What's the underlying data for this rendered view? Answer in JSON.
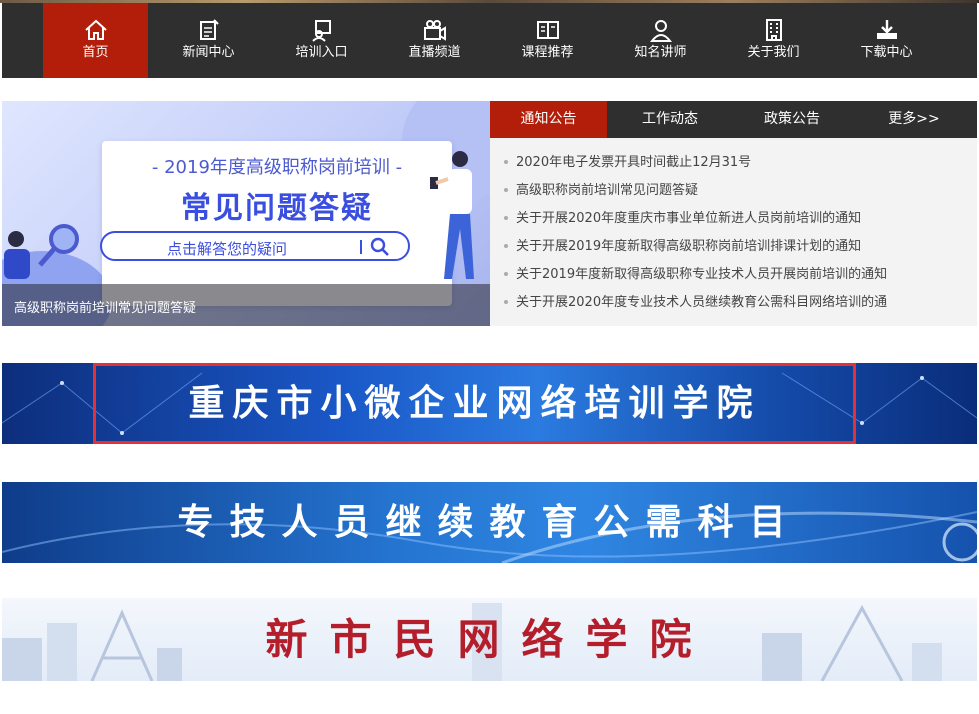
{
  "nav": {
    "items": [
      {
        "label": "首页",
        "icon": "home-icon",
        "active": true
      },
      {
        "label": "新闻中心",
        "icon": "news-edit-icon"
      },
      {
        "label": "培训入口",
        "icon": "training-icon"
      },
      {
        "label": "直播频道",
        "icon": "video-camera-icon"
      },
      {
        "label": "课程推荐",
        "icon": "book-icon"
      },
      {
        "label": "知名讲师",
        "icon": "teacher-icon"
      },
      {
        "label": "关于我们",
        "icon": "building-icon"
      },
      {
        "label": "下载中心",
        "icon": "download-icon"
      }
    ]
  },
  "hero": {
    "subtitle": "- 2019年度高级职称岗前培训 -",
    "title": "常见问题答疑",
    "search_text": "点击解答您的疑问",
    "caption": "高级职称岗前培训常见问题答疑"
  },
  "news": {
    "tabs": [
      "通知公告",
      "工作动态",
      "政策公告",
      "更多>>"
    ],
    "items": [
      "2020年电子发票开具时间截止12月31号",
      "高级职称岗前培训常见问题答疑",
      "关于开展2020年度重庆市事业单位新进人员岗前培训的通知",
      "关于开展2019年度新取得高级职称岗前培训排课计划的通知",
      "关于2019年度新取得高级职称专业技术人员开展岗前培训的通知",
      "关于开展2020年度专业技术人员继续教育公需科目网络培训的通"
    ]
  },
  "banners": {
    "b1": "重庆市小微企业网络培训学院",
    "b2": "专技人员继续教育公需科目",
    "b3": "新市民网络学院"
  },
  "colors": {
    "nav_bg": "#2f2f2f",
    "accent_red": "#b31e0a",
    "banner_blue": "#1a58c8"
  }
}
